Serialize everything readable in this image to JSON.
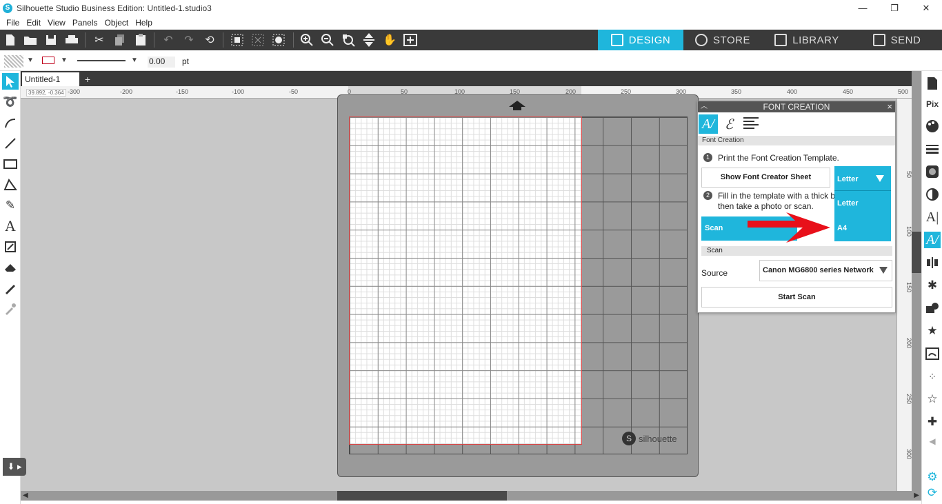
{
  "window": {
    "title": "Silhouette Studio Business Edition: Untitled-1.studio3",
    "controls": [
      "—",
      "❐",
      "✕"
    ]
  },
  "menu": [
    "File",
    "Edit",
    "View",
    "Panels",
    "Object",
    "Help"
  ],
  "nav_tabs": [
    {
      "label": "DESIGN",
      "active": true
    },
    {
      "label": "STORE",
      "active": false
    },
    {
      "label": "LIBRARY",
      "active": false
    },
    {
      "label": "SEND",
      "active": false
    }
  ],
  "line_bar": {
    "width_value": "0.00",
    "unit": "pt"
  },
  "doc": {
    "tab_label": "Untitled-1",
    "add_label": "+"
  },
  "ruler": {
    "coord_readout": "39.892, -0.364",
    "h_labels": [
      "-300",
      "-250",
      "-200",
      "-150",
      "-100",
      "-50",
      "0",
      "50",
      "100",
      "150",
      "200",
      "250",
      "300",
      "350",
      "400",
      "450",
      "500"
    ],
    "v_labels": [
      "50",
      "100",
      "150",
      "200",
      "250",
      "300"
    ]
  },
  "mat": {
    "brand": "silhouette"
  },
  "font_panel": {
    "title": "FONT CREATION",
    "section": "Font Creation",
    "step1": "Print the Font Creation Template.",
    "step2_line1": "Fill in the template with a thick b",
    "step2_line2": "then take a photo or scan.",
    "show_sheet_button": "Show Font Creator Sheet",
    "scan_button": "Scan",
    "scan_section": "Scan",
    "source_label": "Source",
    "source_value": "Canon MG6800 series Network",
    "start_scan_button": "Start Scan",
    "paper_dropdown": {
      "selected": "Letter",
      "options": [
        "Letter",
        "A4"
      ]
    }
  },
  "colors": {
    "accent": "#1fb6dc",
    "toolbar": "#3a3a3a",
    "canvas": "#c8c8c8",
    "annotation_arrow": "#e8101a"
  }
}
